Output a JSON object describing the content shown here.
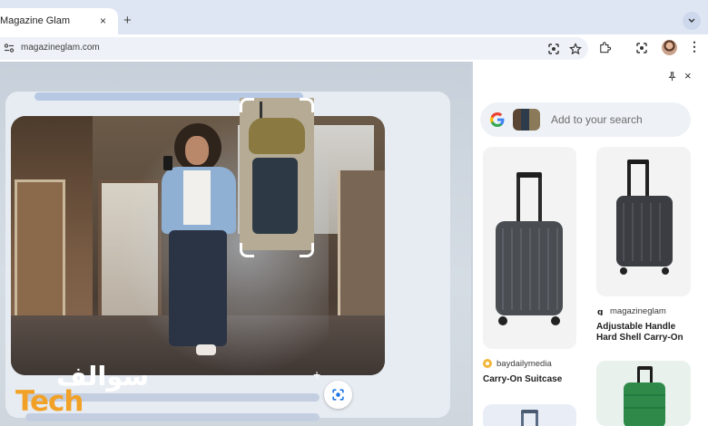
{
  "browser": {
    "tab_title": "Magazine Glam",
    "tab_close": "×",
    "new_tab": "+",
    "url": "magazineglam.com",
    "toolbar_icons": [
      "lens-icon",
      "star-icon",
      "extensions-icon",
      "lens-icon",
      "profile-avatar",
      "kebab-menu-icon"
    ],
    "kebab": "⋮"
  },
  "side_panel": {
    "pin": "📌",
    "close": "×",
    "search_placeholder": "Add to your search",
    "results": [
      {
        "source": "",
        "title": "",
        "color": "#4a4d52"
      },
      {
        "source": "magazineglam",
        "title": "Adjustable Handle Hard Shell Carry-On",
        "color": "#3b3d42"
      },
      {
        "source": "baydailymedia",
        "title": "Carry-On Suitcase",
        "color": "#4a4d52"
      },
      {
        "source": "",
        "title": "",
        "color": "#2f8a4a"
      },
      {
        "source": "",
        "title": "",
        "color": "#5a6b85"
      }
    ]
  },
  "watermark": {
    "arabic": "سوالف",
    "english": "Tech"
  },
  "colors": {
    "accent": "#1a73e8",
    "watermark_orange": "#f2a127"
  }
}
